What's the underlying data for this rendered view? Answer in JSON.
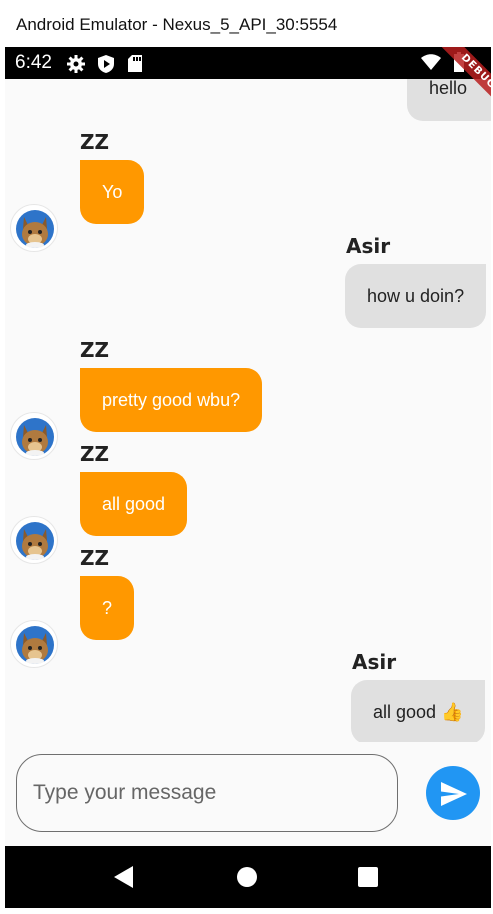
{
  "window": {
    "title": "Android Emulator - Nexus_5_API_30:5554"
  },
  "status_bar": {
    "time": "6:42",
    "left_icons": [
      "gear-icon",
      "play-protect-icon",
      "sd-card-icon"
    ],
    "right_icons": [
      "wifi-icon",
      "battery-icon"
    ]
  },
  "debug_banner": "DEBUG",
  "chat": {
    "partial_top_message": "hello",
    "messages": [
      {
        "sender": "ZZ",
        "text": "Yo",
        "direction": "incoming"
      },
      {
        "sender": "Asir",
        "text": "how u doin?",
        "direction": "outgoing"
      },
      {
        "sender": "ZZ",
        "text": "pretty good wbu?",
        "direction": "incoming"
      },
      {
        "sender": "ZZ",
        "text": "all good",
        "direction": "incoming"
      },
      {
        "sender": "ZZ",
        "text": "?",
        "direction": "incoming"
      },
      {
        "sender": "Asir",
        "text": "all good 👍",
        "direction": "outgoing"
      }
    ]
  },
  "composer": {
    "placeholder": "Type your message",
    "send_icon": "send-icon"
  },
  "nav": {
    "buttons": [
      "back-icon",
      "home-icon",
      "recents-icon"
    ]
  },
  "colors": {
    "incoming": "#ff9800",
    "outgoing": "#e0e0e0",
    "accent": "#2196f3"
  }
}
